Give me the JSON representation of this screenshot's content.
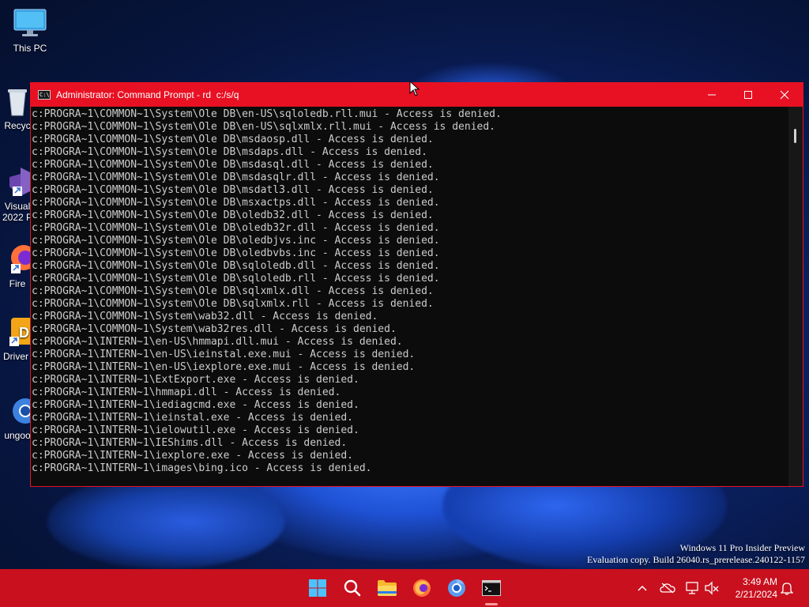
{
  "desktop": {
    "icons": [
      {
        "label": "This PC",
        "icon": "monitor-icon"
      },
      {
        "label": "Recyc",
        "icon": "recycle-bin-icon"
      },
      {
        "label": "Visual",
        "label2": "2022 P",
        "icon": "visual-studio-icon"
      },
      {
        "label": "Fire",
        "icon": "firefox-icon"
      },
      {
        "label": "Driver",
        "icon": "driver-app-icon"
      },
      {
        "label": "ungoo",
        "icon": "chromium-icon"
      }
    ],
    "watermark": {
      "line1": "Windows 11 Pro Insider Preview",
      "line2": "Evaluation copy. Build 26040.rs_prerelease.240122-1157"
    }
  },
  "window": {
    "title": "Administrator: Command Prompt - rd  c:/s/q",
    "icon": "cmd-icon",
    "title_icon_text": "C:\\",
    "lines": [
      "c:PROGRA~1\\COMMON~1\\System\\Ole DB\\en-US\\sqloledb.rll.mui - Access is denied.",
      "c:PROGRA~1\\COMMON~1\\System\\Ole DB\\en-US\\sqlxmlx.rll.mui - Access is denied.",
      "c:PROGRA~1\\COMMON~1\\System\\Ole DB\\msdaosp.dll - Access is denied.",
      "c:PROGRA~1\\COMMON~1\\System\\Ole DB\\msdaps.dll - Access is denied.",
      "c:PROGRA~1\\COMMON~1\\System\\Ole DB\\msdasql.dll - Access is denied.",
      "c:PROGRA~1\\COMMON~1\\System\\Ole DB\\msdasqlr.dll - Access is denied.",
      "c:PROGRA~1\\COMMON~1\\System\\Ole DB\\msdatl3.dll - Access is denied.",
      "c:PROGRA~1\\COMMON~1\\System\\Ole DB\\msxactps.dll - Access is denied.",
      "c:PROGRA~1\\COMMON~1\\System\\Ole DB\\oledb32.dll - Access is denied.",
      "c:PROGRA~1\\COMMON~1\\System\\Ole DB\\oledb32r.dll - Access is denied.",
      "c:PROGRA~1\\COMMON~1\\System\\Ole DB\\oledbjvs.inc - Access is denied.",
      "c:PROGRA~1\\COMMON~1\\System\\Ole DB\\oledbvbs.inc - Access is denied.",
      "c:PROGRA~1\\COMMON~1\\System\\Ole DB\\sqloledb.dll - Access is denied.",
      "c:PROGRA~1\\COMMON~1\\System\\Ole DB\\sqloledb.rll - Access is denied.",
      "c:PROGRA~1\\COMMON~1\\System\\Ole DB\\sqlxmlx.dll - Access is denied.",
      "c:PROGRA~1\\COMMON~1\\System\\Ole DB\\sqlxmlx.rll - Access is denied.",
      "c:PROGRA~1\\COMMON~1\\System\\wab32.dll - Access is denied.",
      "c:PROGRA~1\\COMMON~1\\System\\wab32res.dll - Access is denied.",
      "c:PROGRA~1\\INTERN~1\\en-US\\hmmapi.dll.mui - Access is denied.",
      "c:PROGRA~1\\INTERN~1\\en-US\\ieinstal.exe.mui - Access is denied.",
      "c:PROGRA~1\\INTERN~1\\en-US\\iexplore.exe.mui - Access is denied.",
      "c:PROGRA~1\\INTERN~1\\ExtExport.exe - Access is denied.",
      "c:PROGRA~1\\INTERN~1\\hmmapi.dll - Access is denied.",
      "c:PROGRA~1\\INTERN~1\\iediagcmd.exe - Access is denied.",
      "c:PROGRA~1\\INTERN~1\\ieinstal.exe - Access is denied.",
      "c:PROGRA~1\\INTERN~1\\ielowutil.exe - Access is denied.",
      "c:PROGRA~1\\INTERN~1\\IEShims.dll - Access is denied.",
      "c:PROGRA~1\\INTERN~1\\iexplore.exe - Access is denied.",
      "c:PROGRA~1\\INTERN~1\\images\\bing.ico - Access is denied."
    ]
  },
  "taskbar": {
    "apps": [
      {
        "name": "start-button",
        "icon": "windows-logo-icon"
      },
      {
        "name": "search-button",
        "icon": "search-icon"
      },
      {
        "name": "file-explorer-button",
        "icon": "folder-icon"
      },
      {
        "name": "firefox-button",
        "icon": "firefox-icon"
      },
      {
        "name": "chromium-button",
        "icon": "chromium-icon"
      },
      {
        "name": "terminal-button",
        "icon": "cmd-icon",
        "active": true
      }
    ],
    "tray": {
      "icons": [
        "chevron-up-icon",
        "onedrive-offline-icon",
        "network-icon",
        "volume-muted-icon"
      ],
      "time": "3:49 AM",
      "date": "2/21/2024",
      "notification_icon": "bell-icon"
    }
  },
  "colors": {
    "accent_red": "#e81123",
    "taskbar": "#c8101e",
    "console_bg": "#0c0c0c",
    "console_text": "#cccccc"
  }
}
